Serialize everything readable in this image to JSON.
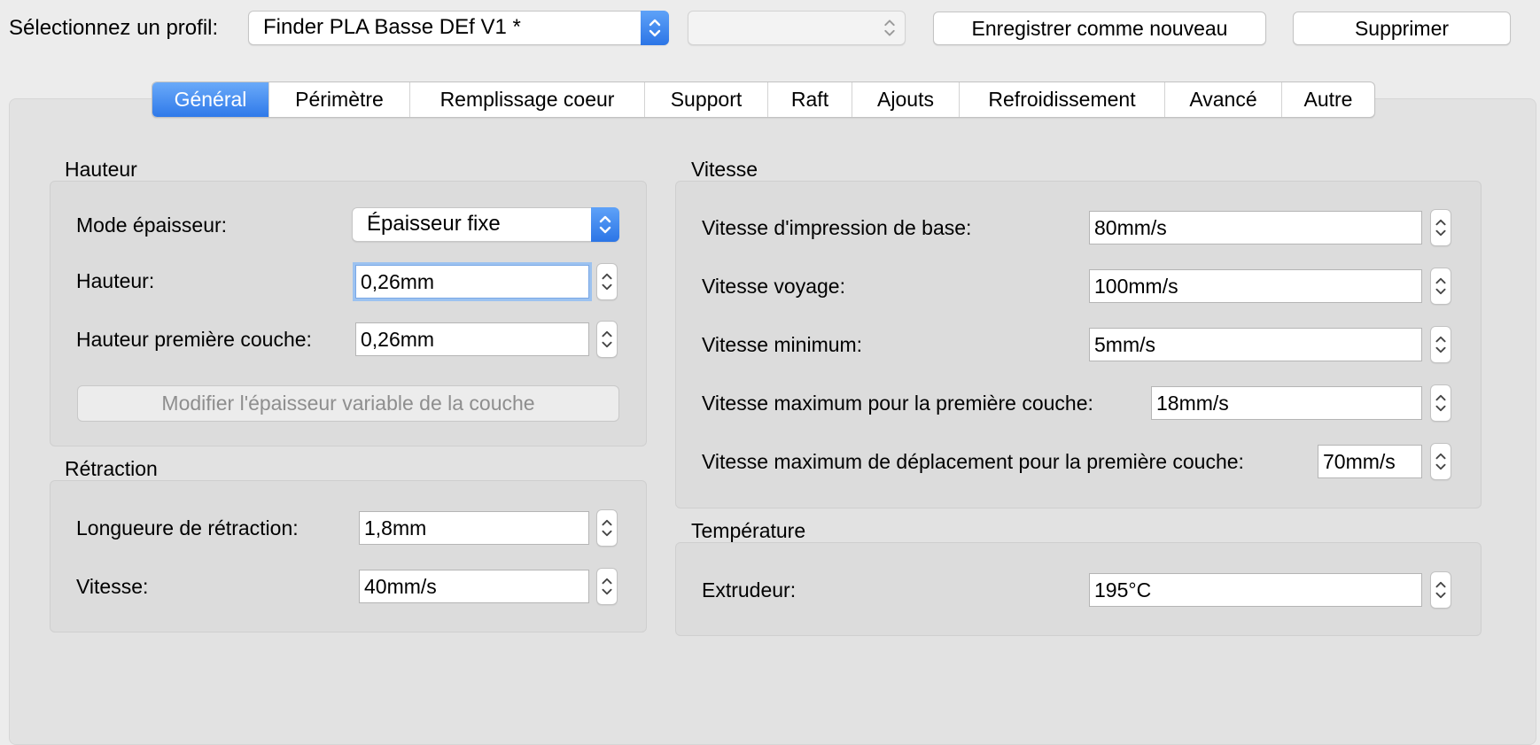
{
  "topbar": {
    "profile_label": "Sélectionnez un profil:",
    "profile_value": "Finder PLA Basse DEf V1 *",
    "secondary_value": "",
    "save_new_label": "Enregistrer comme nouveau",
    "delete_label": "Supprimer"
  },
  "tabs": [
    "Général",
    "Périmètre",
    "Remplissage coeur",
    "Support",
    "Raft",
    "Ajouts",
    "Refroidissement",
    "Avancé",
    "Autre"
  ],
  "active_tab": "Général",
  "hauteur": {
    "title": "Hauteur",
    "mode_label": "Mode épaisseur:",
    "mode_value": "Épaisseur fixe",
    "height_label": "Hauteur:",
    "height_value": "0,26mm",
    "first_layer_label": "Hauteur première couche:",
    "first_layer_value": "0,26mm",
    "variable_button": "Modifier l'épaisseur variable de la couche"
  },
  "retraction": {
    "title": "Rétraction",
    "length_label": "Longueure de rétraction:",
    "length_value": "1,8mm",
    "speed_label": "Vitesse:",
    "speed_value": "40mm/s"
  },
  "vitesse": {
    "title": "Vitesse",
    "base_label": "Vitesse d'impression de base:",
    "base_value": "80mm/s",
    "travel_label": "Vitesse voyage:",
    "travel_value": "100mm/s",
    "min_label": "Vitesse minimum:",
    "min_value": "5mm/s",
    "max_first_label": "Vitesse maximum pour la première couche:",
    "max_first_value": "18mm/s",
    "max_travel_first_label": "Vitesse maximum de déplacement pour la première couche:",
    "max_travel_first_value": "70mm/s"
  },
  "temperature": {
    "title": "Température",
    "extruder_label": "Extrudeur:",
    "extruder_value": "195°C"
  },
  "colors": {
    "accent": "#2f79e9",
    "window_bg": "#ececec",
    "panel_bg": "#e2e2e2"
  },
  "icons": [
    "chevron-updown-icon",
    "stepper-icon"
  ]
}
